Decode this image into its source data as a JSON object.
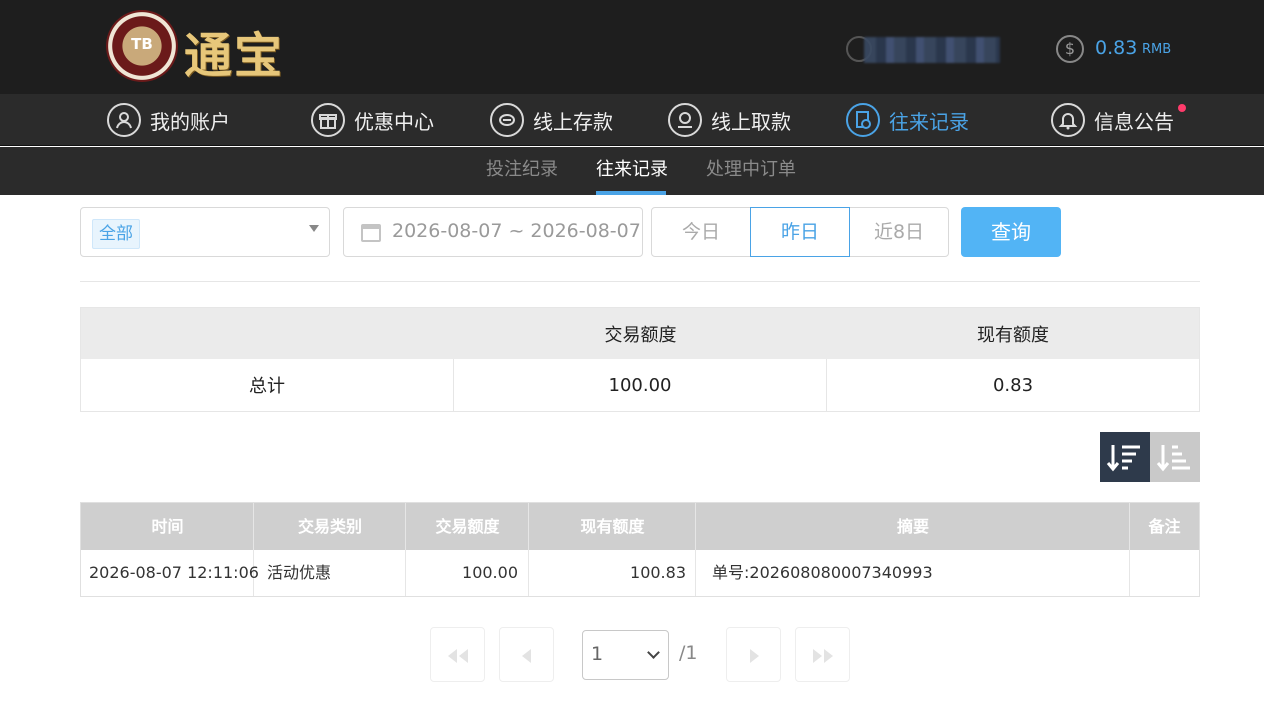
{
  "header": {
    "logo_chip": "TB",
    "logo_text": "通宝",
    "balance_amount": "0.83",
    "balance_currency": "RMB"
  },
  "main_nav": {
    "items": [
      {
        "label": "我的账户",
        "icon": "user-icon"
      },
      {
        "label": "优惠中心",
        "icon": "gift-icon"
      },
      {
        "label": "线上存款",
        "icon": "deposit-icon"
      },
      {
        "label": "线上取款",
        "icon": "withdraw-icon"
      },
      {
        "label": "往来记录",
        "icon": "records-icon",
        "active": true
      },
      {
        "label": "信息公告",
        "icon": "bell-icon",
        "has_notification": true
      }
    ]
  },
  "sub_nav": {
    "items": [
      {
        "label": "投注纪录"
      },
      {
        "label": "往来记录",
        "active": true
      },
      {
        "label": "处理中订单"
      }
    ]
  },
  "filter": {
    "type_selected": "全部",
    "date_range": "2026-08-07 ~ 2026-08-07",
    "quick_buttons": [
      "今日",
      "昨日",
      "近8日"
    ],
    "quick_active": "昨日",
    "query_label": "查询"
  },
  "summary": {
    "headers": [
      "",
      "交易额度",
      "现有额度"
    ],
    "row": {
      "label": "总计",
      "transaction": "100.00",
      "balance": "0.83"
    }
  },
  "records": {
    "columns": [
      "时间",
      "交易类别",
      "交易额度",
      "现有额度",
      "摘要",
      "备注"
    ],
    "rows": [
      {
        "time": "2026-08-07 12:11:06",
        "type": "活动优惠",
        "amount": "100.00",
        "balance": "100.83",
        "summary": "单号:202608080007340993",
        "remark": ""
      }
    ]
  },
  "pagination": {
    "current_page": "1",
    "total_text": "/1"
  },
  "colors": {
    "accent": "#4aa3e6",
    "header_bg": "#1e1e1e",
    "nav_bg": "#2b2b2b",
    "query_button": "#52b4f5",
    "notification_dot": "#ff3b6b"
  }
}
